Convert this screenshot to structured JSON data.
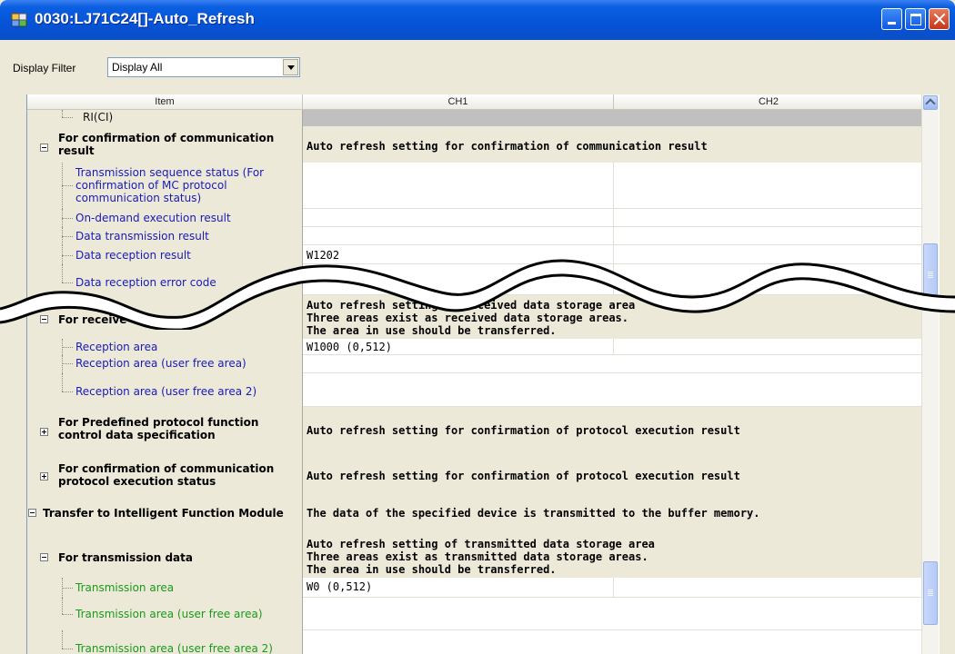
{
  "window": {
    "title": "0030:LJ71C24[]-Auto_Refresh",
    "titlebar_color": "#0553d8",
    "controls": [
      "minimize-icon",
      "maximize-icon",
      "close-icon"
    ]
  },
  "filter": {
    "label": "Display Filter",
    "value": "Display All"
  },
  "grid": {
    "columns": [
      "Item",
      "CH1",
      "CH2"
    ],
    "rows": {
      "ri": {
        "label": "RI(CI)"
      },
      "conf_comm": {
        "label_l1": "For confirmation of communication",
        "label_l2": "result",
        "ch": "Auto refresh setting for confirmation of communication result"
      },
      "trans_seq": {
        "label_l1": "Transmission sequence status (For",
        "label_l2": "confirmation of MC protocol",
        "label_l3": "communication status)"
      },
      "on_demand": {
        "label": "On-demand execution result"
      },
      "data_tx": {
        "label": "Data transmission result"
      },
      "data_rx": {
        "label": "Data reception result",
        "ch1": "W1202"
      },
      "rx_err": {
        "label": "Data reception error code"
      },
      "receive": {
        "label": "For receive data",
        "ch_l1": "Auto refresh setting of received data storage area",
        "ch_l2": "Three areas exist as received data storage areas.",
        "ch_l3": "The area in use should be transferred."
      },
      "rx_area": {
        "label": "Reception area",
        "ch1": "W1000 (0,512)"
      },
      "rx_area_free": {
        "label": "Reception area (user free area)"
      },
      "rx_area_free2": {
        "label": "Reception area (user free area 2)"
      },
      "predef": {
        "label_l1": "For Predefined protocol function",
        "label_l2": "control data specification",
        "ch": "Auto refresh setting for confirmation of protocol execution result"
      },
      "conf_proto": {
        "label_l1": "For confirmation of communication",
        "label_l2": "protocol execution status",
        "ch": "Auto refresh setting for confirmation of protocol execution result"
      },
      "xfer": {
        "label": "Transfer to Intelligent Function Module",
        "ch": "The data of the specified device is transmitted to the buffer memory."
      },
      "tx_data": {
        "label": "For transmission data",
        "ch_l1": "Auto refresh setting of transmitted data storage area",
        "ch_l2": "Three areas exist as transmitted data storage areas.",
        "ch_l3": "The area in use should be transferred."
      },
      "tx_area": {
        "label": "Transmission area",
        "ch1": "W0 (0,512)"
      },
      "tx_area_free": {
        "label": "Transmission area (user free area)"
      },
      "tx_area_free2": {
        "label": "Transmission area (user free area 2)"
      }
    }
  },
  "colors": {
    "sub_item": "#1a1ab8",
    "tx_item": "#1a9a1a",
    "group_bg": "#ece9d8"
  }
}
